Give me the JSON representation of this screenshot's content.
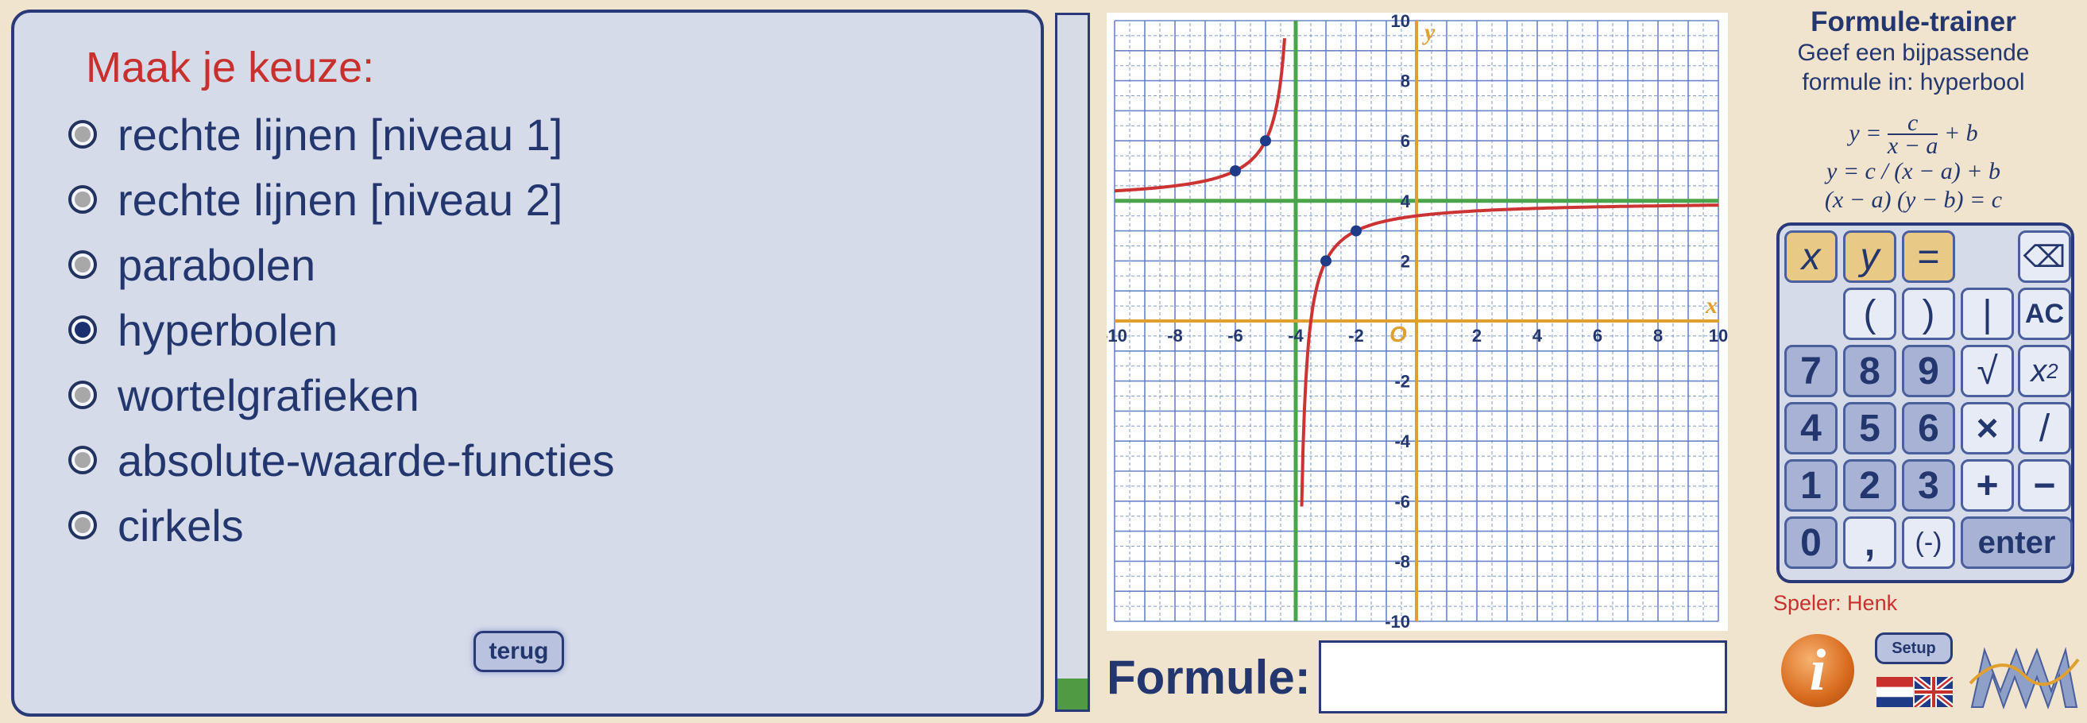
{
  "choice": {
    "title": "Maak je keuze:",
    "options": [
      {
        "label": "rechte lijnen [niveau 1]",
        "selected": false
      },
      {
        "label": "rechte lijnen [niveau 2]",
        "selected": false
      },
      {
        "label": "parabolen",
        "selected": false
      },
      {
        "label": "hyperbolen",
        "selected": true
      },
      {
        "label": "wortelgrafieken",
        "selected": false
      },
      {
        "label": "absolute-waarde-functies",
        "selected": false
      },
      {
        "label": "cirkels",
        "selected": false
      }
    ],
    "back_label": "terug"
  },
  "progress": {
    "fraction": 0.045
  },
  "graph": {
    "x_axis_label": "x",
    "y_axis_label": "y",
    "origin_label": "O",
    "x_ticks": [
      "-10",
      "-8",
      "-6",
      "-4",
      "-2",
      "2",
      "4",
      "6",
      "8",
      "10"
    ],
    "y_ticks": [
      "10",
      "8",
      "6",
      "4",
      "2",
      "-2",
      "-4",
      "-6",
      "-8",
      "-10"
    ],
    "asymptote_x": -4,
    "asymptote_y": 4,
    "c": -2,
    "points": [
      [
        -6,
        5
      ],
      [
        -5,
        6
      ],
      [
        -3,
        2
      ],
      [
        -2,
        3
      ]
    ],
    "colors": {
      "axis": "#e0a030",
      "asymptote": "#4aa54a",
      "curve": "#cc3333",
      "grid": "#5a7ac0",
      "point": "#1f3a86"
    }
  },
  "formula": {
    "label": "Formule:",
    "value": ""
  },
  "info": {
    "title": "Formule-trainer",
    "line1": "Geef een bijpassende",
    "line2": "formule in: hyperbool",
    "f1_left": "y =",
    "f1_num": "c",
    "f1_den": "x − a",
    "f1_right": "+ b",
    "f2": "y = c / (x − a) + b",
    "f3": "(x − a) (y − b) = c"
  },
  "keypad": {
    "keys": {
      "x": "x",
      "y": "y",
      "eq": "=",
      "backspace": "⌫",
      "lparen": "(",
      "rparen": ")",
      "abs": "|",
      "ac": "AC",
      "k7": "7",
      "k8": "8",
      "k9": "9",
      "sqrt": "√",
      "sq_base": "x",
      "sq_exp": "2",
      "k4": "4",
      "k5": "5",
      "k6": "6",
      "mul": "×",
      "div": "/",
      "k1": "1",
      "k2": "2",
      "k3": "3",
      "plus": "+",
      "minus": "−",
      "k0": "0",
      "comma": ",",
      "neg": "(-)",
      "enter": "enter"
    }
  },
  "player": "Speler: Henk",
  "setup_label": "Setup",
  "info_button_glyph": "i"
}
